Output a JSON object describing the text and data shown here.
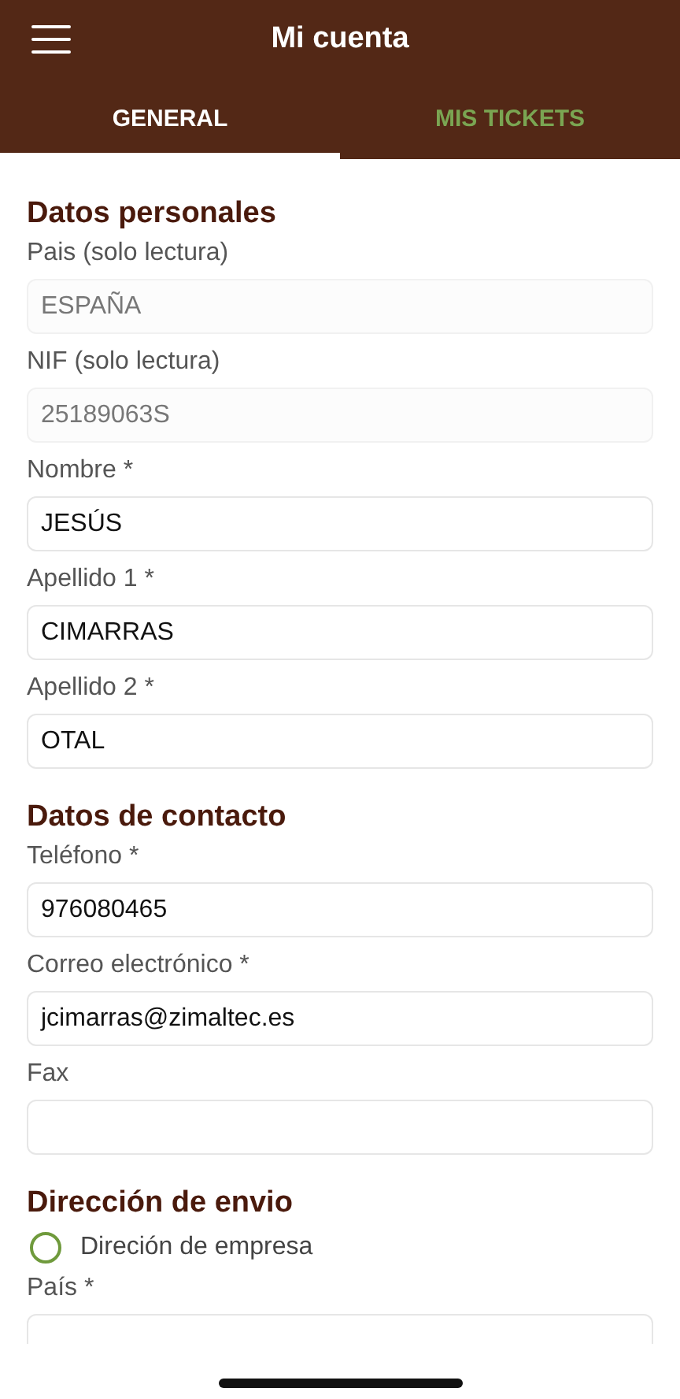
{
  "header": {
    "title": "Mi cuenta"
  },
  "tabs": [
    {
      "label": "GENERAL",
      "selected": true
    },
    {
      "label": "MIS TICKETS",
      "selected": false
    }
  ],
  "form": [
    {
      "kind": "section",
      "title": "Datos personales"
    },
    {
      "kind": "field",
      "label": "Pais (solo lectura)",
      "value": "ESPAÑA",
      "readonly": true
    },
    {
      "kind": "field",
      "label": "NIF (solo lectura)",
      "value": "25189063S",
      "readonly": true
    },
    {
      "kind": "field",
      "label": "Nombre *",
      "value": "JESÚS",
      "readonly": false
    },
    {
      "kind": "field",
      "label": "Apellido 1 *",
      "value": "CIMARRAS",
      "readonly": false
    },
    {
      "kind": "field",
      "label": "Apellido 2 *",
      "value": "OTAL",
      "readonly": false
    },
    {
      "kind": "section",
      "title": "Datos de contacto"
    },
    {
      "kind": "field",
      "label": "Teléfono *",
      "value": "976080465",
      "readonly": false
    },
    {
      "kind": "field",
      "label": "Correo electrónico *",
      "value": "jcimarras@zimaltec.es",
      "readonly": false
    },
    {
      "kind": "field",
      "label": "Fax"
    },
    {
      "kind": "section",
      "title": "Dirección de envio"
    },
    {
      "kind": "radio",
      "label": "Direción de empresa",
      "selected": false
    },
    {
      "kind": "field",
      "label": "País *"
    }
  ]
}
